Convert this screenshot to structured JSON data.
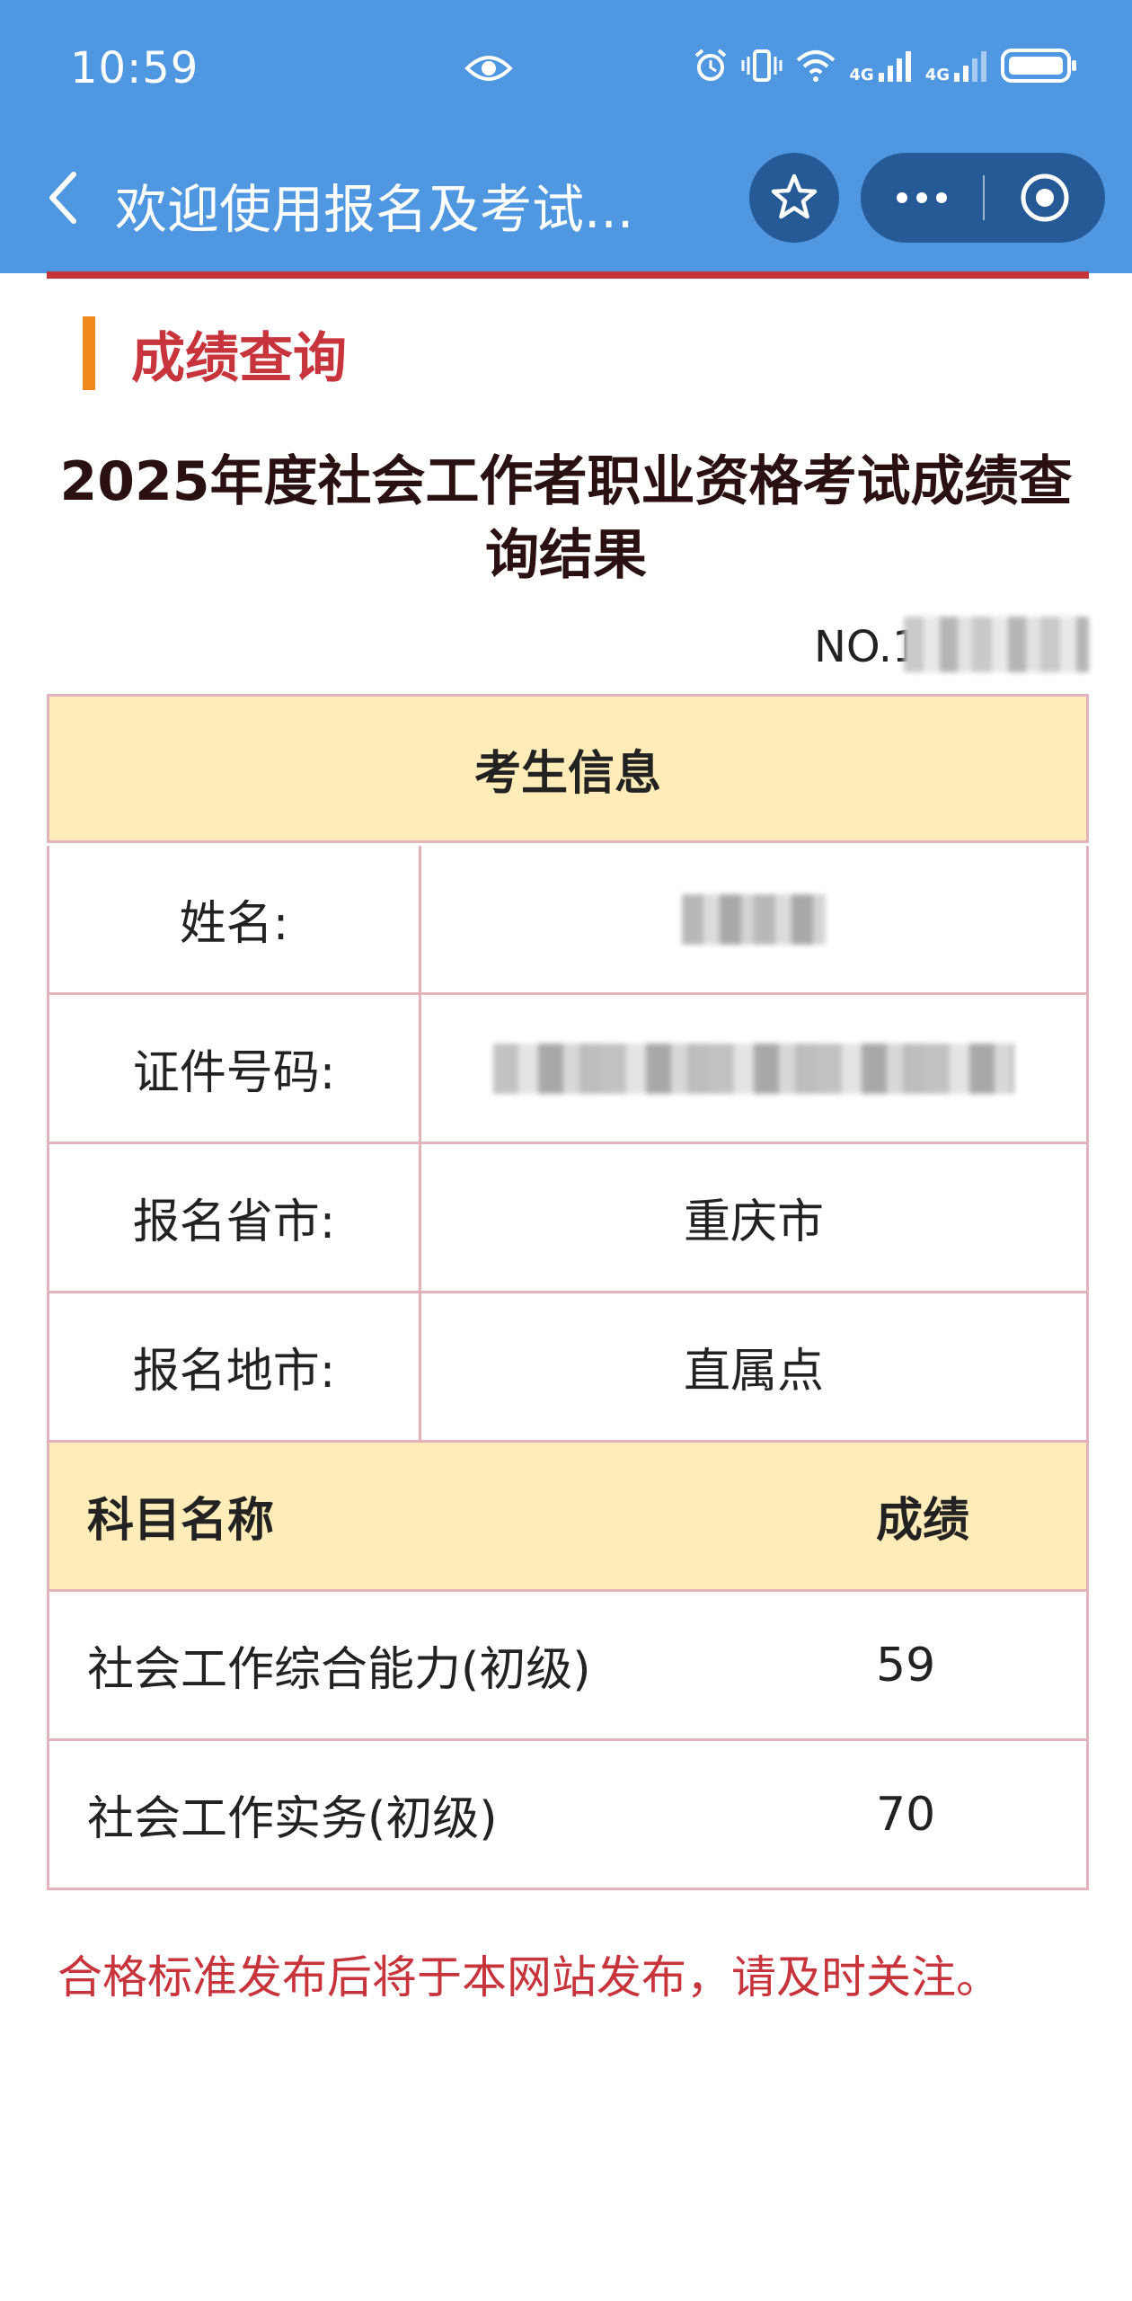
{
  "status_bar": {
    "time": "10:59",
    "network_1": "4G",
    "network_2": "4G",
    "icons": [
      "eye-icon",
      "alarm-icon",
      "vibrate-icon",
      "wifi-icon",
      "signal-icon",
      "battery-icon"
    ]
  },
  "nav": {
    "title": "欢迎使用报名及考试...",
    "icons": [
      "back-chevron-icon",
      "star-icon",
      "more-dots-icon",
      "close-target-icon"
    ]
  },
  "section": {
    "title": "成绩查询"
  },
  "result": {
    "title": "2025年度社会工作者职业资格考试成绩查询结果",
    "serial_prefix": "NO.1"
  },
  "candidate": {
    "header": "考生信息",
    "rows": [
      {
        "label": "姓名:",
        "value": ""
      },
      {
        "label": "证件号码:",
        "value": ""
      },
      {
        "label": "报名省市:",
        "value": "重庆市"
      },
      {
        "label": "报名地市:",
        "value": "直属点"
      }
    ]
  },
  "scores": {
    "header_subject": "科目名称",
    "header_score": "成绩",
    "rows": [
      {
        "subject": "社会工作综合能力(初级)",
        "score": "59"
      },
      {
        "subject": "社会工作实务(初级)",
        "score": "70"
      }
    ]
  },
  "notice": "合格标准发布后将于本网站发布，请及时关注。",
  "colors": {
    "topbar": "#4f97e0",
    "capsule": "#255a96",
    "accent_red": "#c8343c",
    "accent_orange": "#f08a1e",
    "header_fill": "#ffecb8",
    "border": "#e2b3ba"
  }
}
